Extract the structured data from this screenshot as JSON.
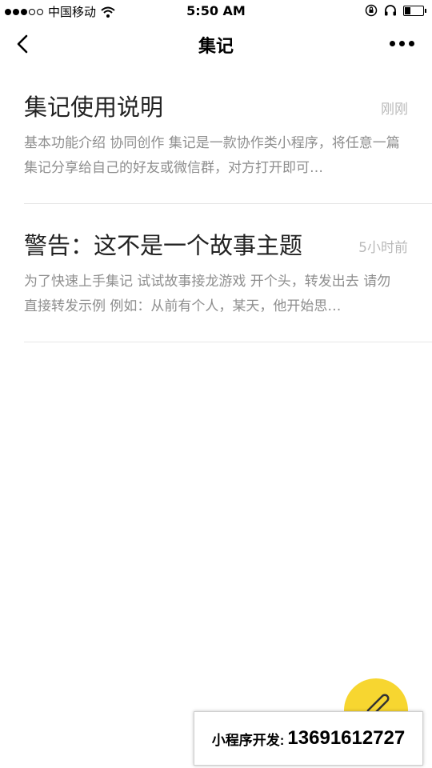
{
  "status_bar": {
    "carrier": "中国移动",
    "time": "5:50 AM",
    "battery_level": 0.3
  },
  "nav": {
    "title": "集记",
    "back_icon": "chevron-left-icon",
    "more_icon": "more-dots-icon"
  },
  "notes": [
    {
      "title": "集记使用说明",
      "time": "刚刚",
      "snippet": "基本功能介绍 协同创作 集记是一款协作类小程序，将任意一篇集记分享给自己的好友或微信群，对方打开即可…"
    },
    {
      "title": "警告：这不是一个故事主题",
      "time": "5小时前",
      "snippet": "为了快速上手集记 试试故事接龙游戏 开个头，转发出去 请勿直接转发示例 例如：从前有个人，某天，他开始思…"
    }
  ],
  "fab": {
    "icon": "pencil-icon",
    "color": "#f7d630"
  },
  "dev_banner": {
    "label": "小程序开发:",
    "phone": "13691612727"
  }
}
